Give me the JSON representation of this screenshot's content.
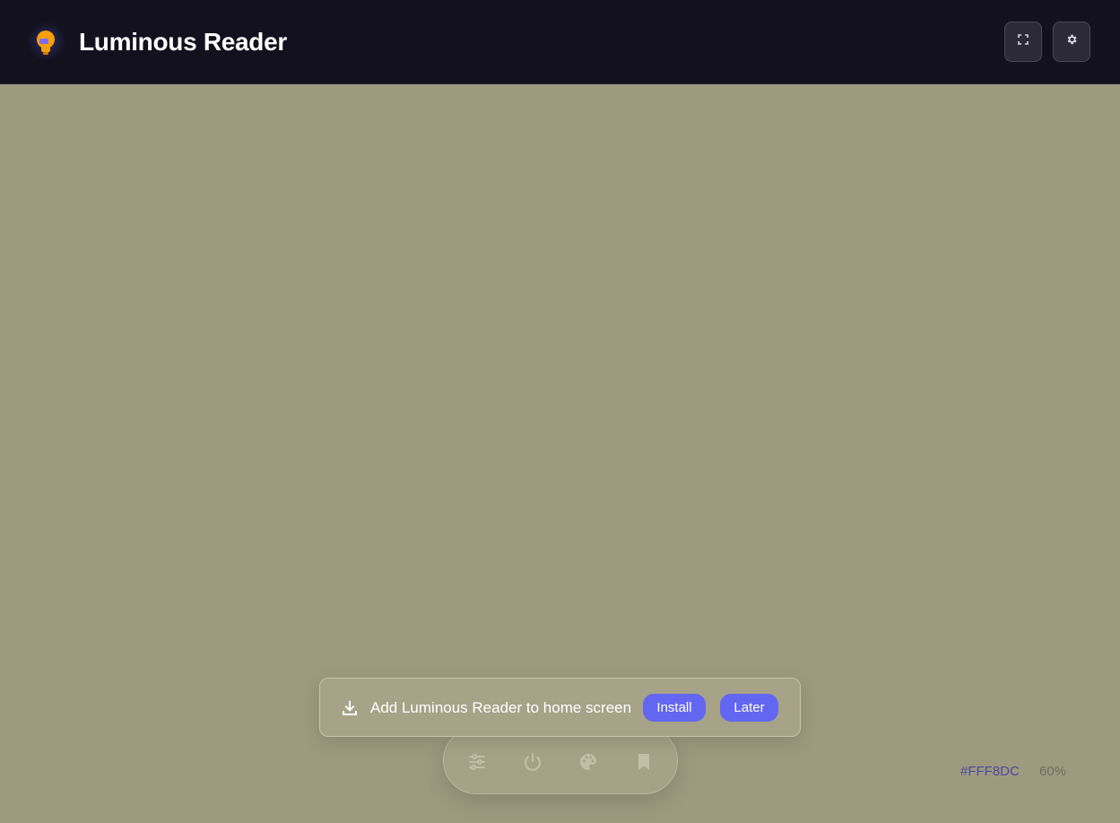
{
  "header": {
    "app_title": "Luminous Reader",
    "logo_icon": "lightbulb-icon",
    "buttons": {
      "fullscreen_icon": "fullscreen-icon",
      "settings_icon": "gear-icon"
    }
  },
  "colors": {
    "header_bg": "#12111d",
    "canvas_bg": "#9e9a80",
    "accent": "#6366f1",
    "logo_orange": "#f59e0b"
  },
  "install_banner": {
    "icon": "download-icon",
    "message": "Add Luminous Reader to home screen",
    "install_label": "Install",
    "later_label": "Later"
  },
  "dock": {
    "items": [
      {
        "icon": "sliders-icon"
      },
      {
        "icon": "power-icon"
      },
      {
        "icon": "palette-icon"
      },
      {
        "icon": "bookmark-icon"
      }
    ]
  },
  "status": {
    "color_code": "#FFF8DC",
    "brightness": "60%"
  }
}
